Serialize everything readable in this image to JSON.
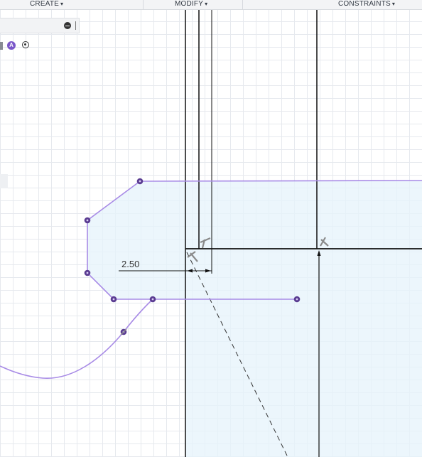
{
  "toolbar": {
    "create_label": "CREATE",
    "modify_label": "MODIFY",
    "constraints_label": "CONSTRAINTS",
    "caret": "▾"
  },
  "browser": {
    "collapse_icon": "minus-circle-icon",
    "grip_icon": "panel-grip-icon"
  },
  "mini_toolbar": {
    "sketch_text_icon": "sketch-text-icon",
    "sketch_text_glyph": "A",
    "target_icon": "target-icon"
  },
  "sketch": {
    "dimension_value": "2.50",
    "colors": {
      "profile_line": "#a88be6",
      "profile_fill": "#e6f3fb",
      "body_line": "#111111",
      "point_fill": "#5a3c91",
      "constraint_glyph": "#8a8a8a",
      "grid": "#e6e9ee"
    }
  }
}
